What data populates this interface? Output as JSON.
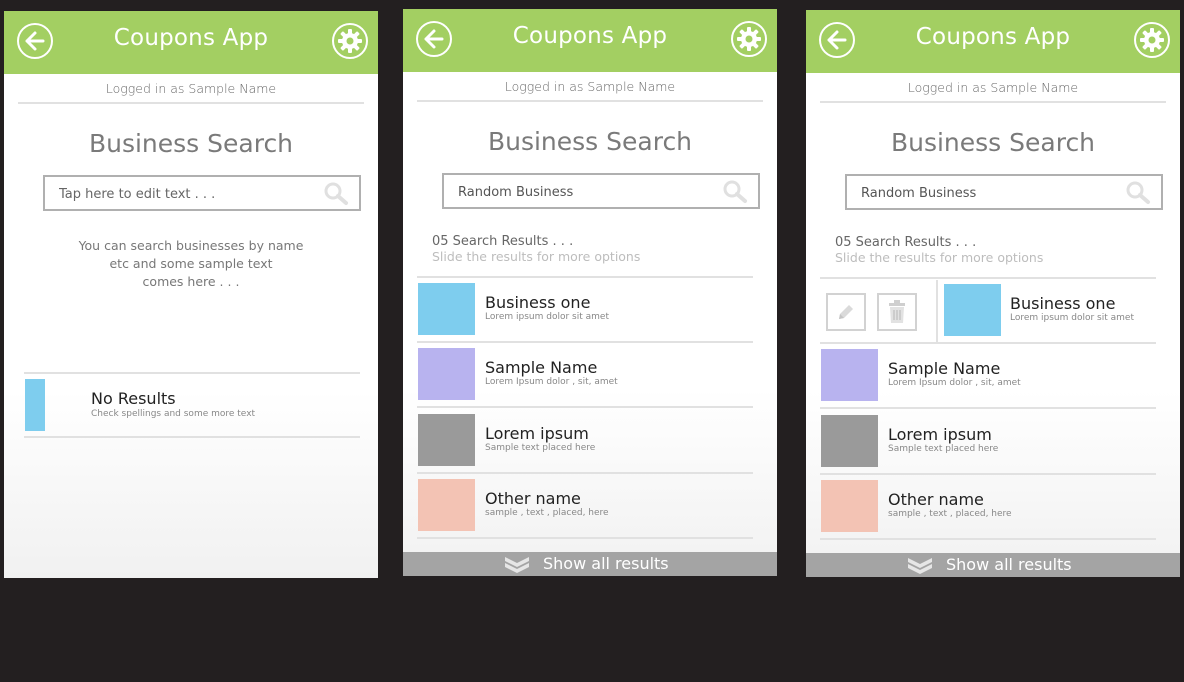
{
  "app": {
    "title": "Coupons App",
    "logged_in": "Logged in as Sample Name"
  },
  "page": {
    "title": "Business Search",
    "show_all": "Show all results"
  },
  "colors": {
    "header": "#a3cf62",
    "blue": "#7ecdee",
    "purple": "#b8b3ef",
    "gray": "#9a9a9a",
    "peach": "#f3c3b4"
  },
  "screen1": {
    "search_placeholder": "Tap here to edit text . . .",
    "info_line1": "You can search businesses by name",
    "info_line2": "etc and some sample text",
    "info_line3": "comes here . . .",
    "no_results_title": "No Results",
    "no_results_sub": "Check spellings and some more text"
  },
  "screen2": {
    "search_value": "Random Business",
    "results_count": "05 Search Results . . .",
    "results_hint": "Slide the results for more options",
    "results": [
      {
        "title": "Business one",
        "sub": "Lorem ipsum dolor sit amet"
      },
      {
        "title": "Sample Name",
        "sub": "Lorem Ipsum dolor , sit, amet"
      },
      {
        "title": "Lorem ipsum",
        "sub": "Sample text placed here"
      },
      {
        "title": "Other name",
        "sub": "sample , text , placed, here"
      }
    ]
  },
  "screen3": {
    "search_value": "Random Business",
    "results_count": "05 Search Results . . .",
    "results_hint": "Slide the results for more options",
    "results": [
      {
        "title": "Business one",
        "sub": "Lorem ipsum dolor sit amet"
      },
      {
        "title": "Sample Name",
        "sub": "Lorem Ipsum dolor , sit, amet"
      },
      {
        "title": "Lorem ipsum",
        "sub": "Sample text placed here"
      },
      {
        "title": "Other name",
        "sub": "sample , text , placed, here"
      }
    ]
  }
}
